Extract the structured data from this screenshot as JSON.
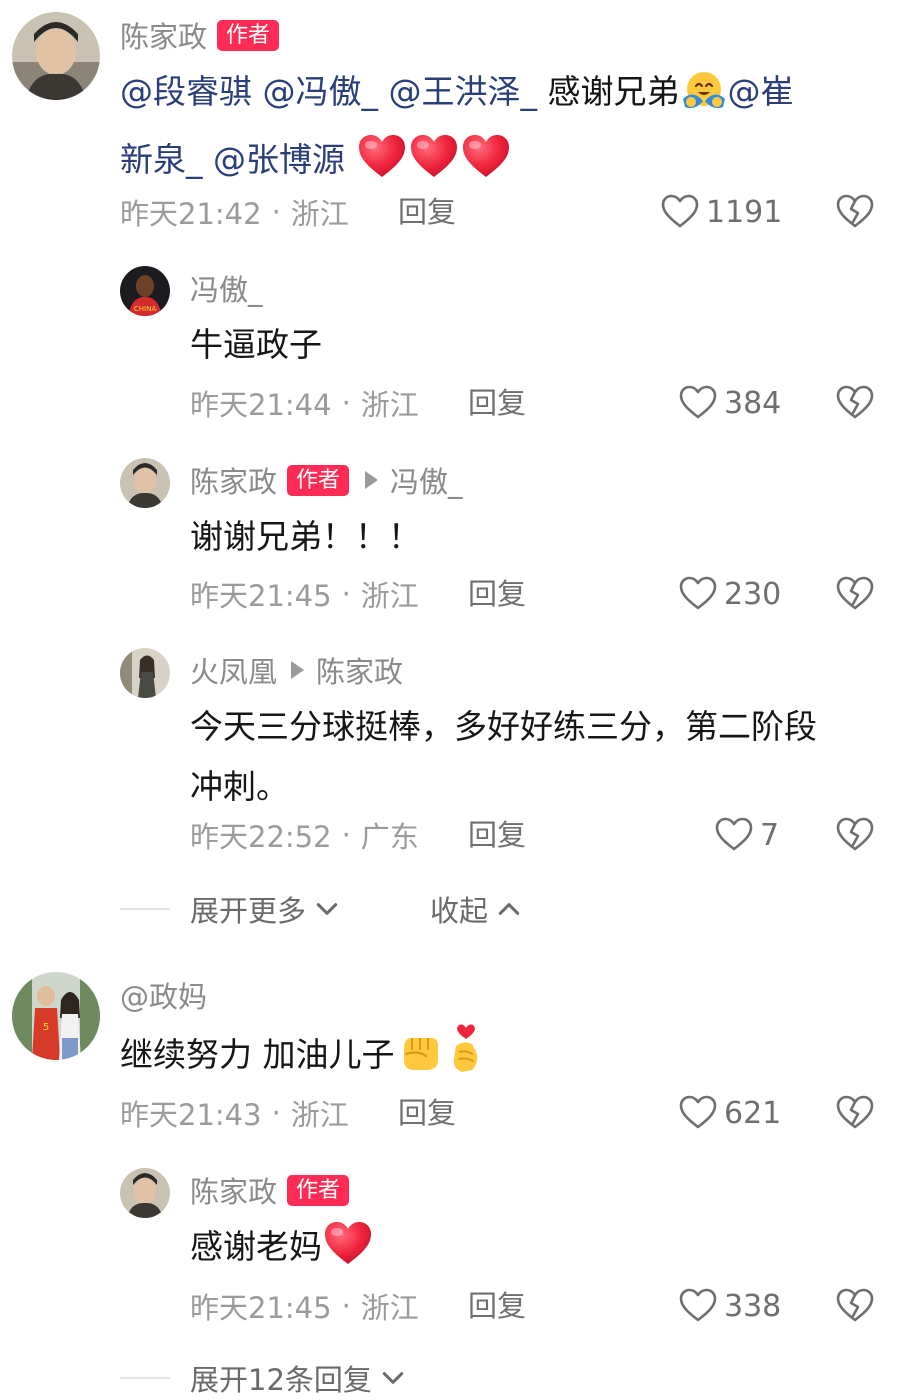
{
  "comments": [
    {
      "author": "陈家政",
      "badge": "作者",
      "content_mentions": [
        "@段睿骐",
        "@冯傲_",
        "@王洪泽_"
      ],
      "content_mid": " 感谢兄弟",
      "content_mention2a": "@崔",
      "content_mention2b": "新泉_",
      "content_mention3": "@张博源",
      "time": "昨天21:42",
      "location": "浙江",
      "reply_label": "回复",
      "likes": "1191"
    },
    {
      "author": "冯傲_",
      "content": "牛逼政子",
      "time": "昨天21:44",
      "location": "浙江",
      "reply_label": "回复",
      "likes": "384"
    },
    {
      "author": "陈家政",
      "badge": "作者",
      "reply_to": "冯傲_",
      "content": "谢谢兄弟！！！",
      "time": "昨天21:45",
      "location": "浙江",
      "reply_label": "回复",
      "likes": "230"
    },
    {
      "author": "火凤凰",
      "reply_to": "陈家政",
      "content_line1": "今天三分球挺棒，多好好练三分，第二阶段",
      "content_line2": "冲刺。",
      "time": "昨天22:52",
      "location": "广东",
      "reply_label": "回复",
      "likes": "7"
    },
    {
      "author": "@政妈",
      "content": "继续努力 加油儿子",
      "time": "昨天21:43",
      "location": "浙江",
      "reply_label": "回复",
      "likes": "621"
    },
    {
      "author": "陈家政",
      "badge": "作者",
      "content": "感谢老妈",
      "time": "昨天21:45",
      "location": "浙江",
      "reply_label": "回复",
      "likes": "338"
    }
  ],
  "meta_separator": "·",
  "expand_more_label": "展开更多",
  "collapse_label": "收起",
  "expand_replies_label": "展开12条回复",
  "colors": {
    "badge": "#fe2c55",
    "mention": "#2c3e7a",
    "heart_emoji": "#f0243c"
  },
  "icons": {
    "like": "heart-outline-icon",
    "dislike": "broken-heart-outline-icon",
    "expand": "chevron-down-icon",
    "collapse": "chevron-up-icon"
  }
}
